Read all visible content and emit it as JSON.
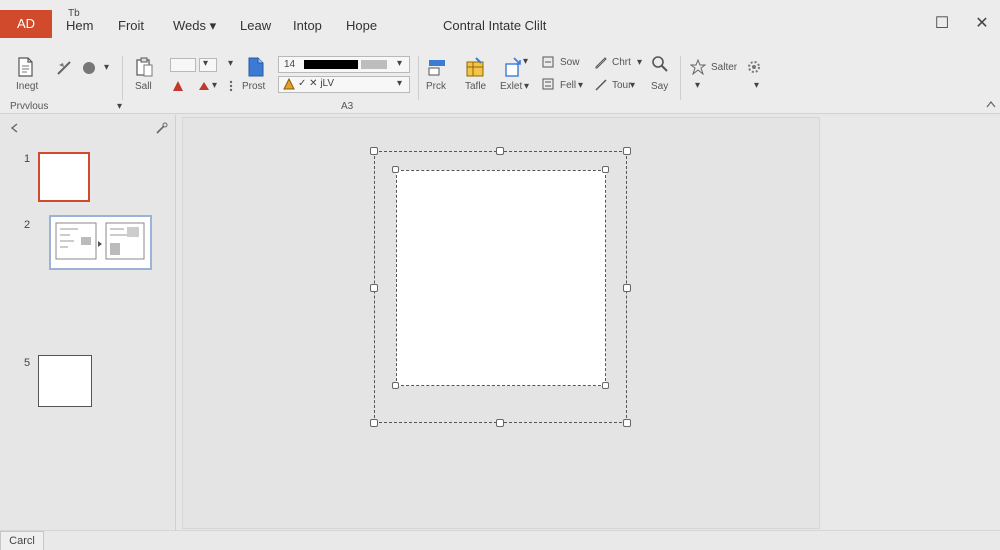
{
  "app": {
    "badge": "AD",
    "title": "Contral Intate Clilt"
  },
  "menu": {
    "super": "Tb",
    "items": [
      "Hem",
      "Froit",
      "Weds ▾",
      "Leaw",
      "Intop",
      "Hope"
    ]
  },
  "window": {
    "restore": "☐",
    "close": "✕"
  },
  "ribbon": {
    "insert": "Inegt",
    "sail": "Sall",
    "fontsize": "14",
    "paste": "Prost",
    "pick": "Prck",
    "table": "Tafle",
    "extract": "Exlet",
    "dropdown_mark": "▾",
    "sow": "Sow",
    "fell": "Fell",
    "chart": "Chrt",
    "tour": "Tour",
    "say": "Say",
    "salter": "Salter",
    "format_text": "✓ ✕ jLV",
    "previous": "Prvvlous",
    "group_mark": "A3"
  },
  "slides": {
    "numbers": [
      "1",
      "2",
      "5"
    ]
  },
  "status": {
    "cancel": "Carcl"
  },
  "colors": {
    "accent": "#d14a2c",
    "selection": "#6a8fc9"
  }
}
